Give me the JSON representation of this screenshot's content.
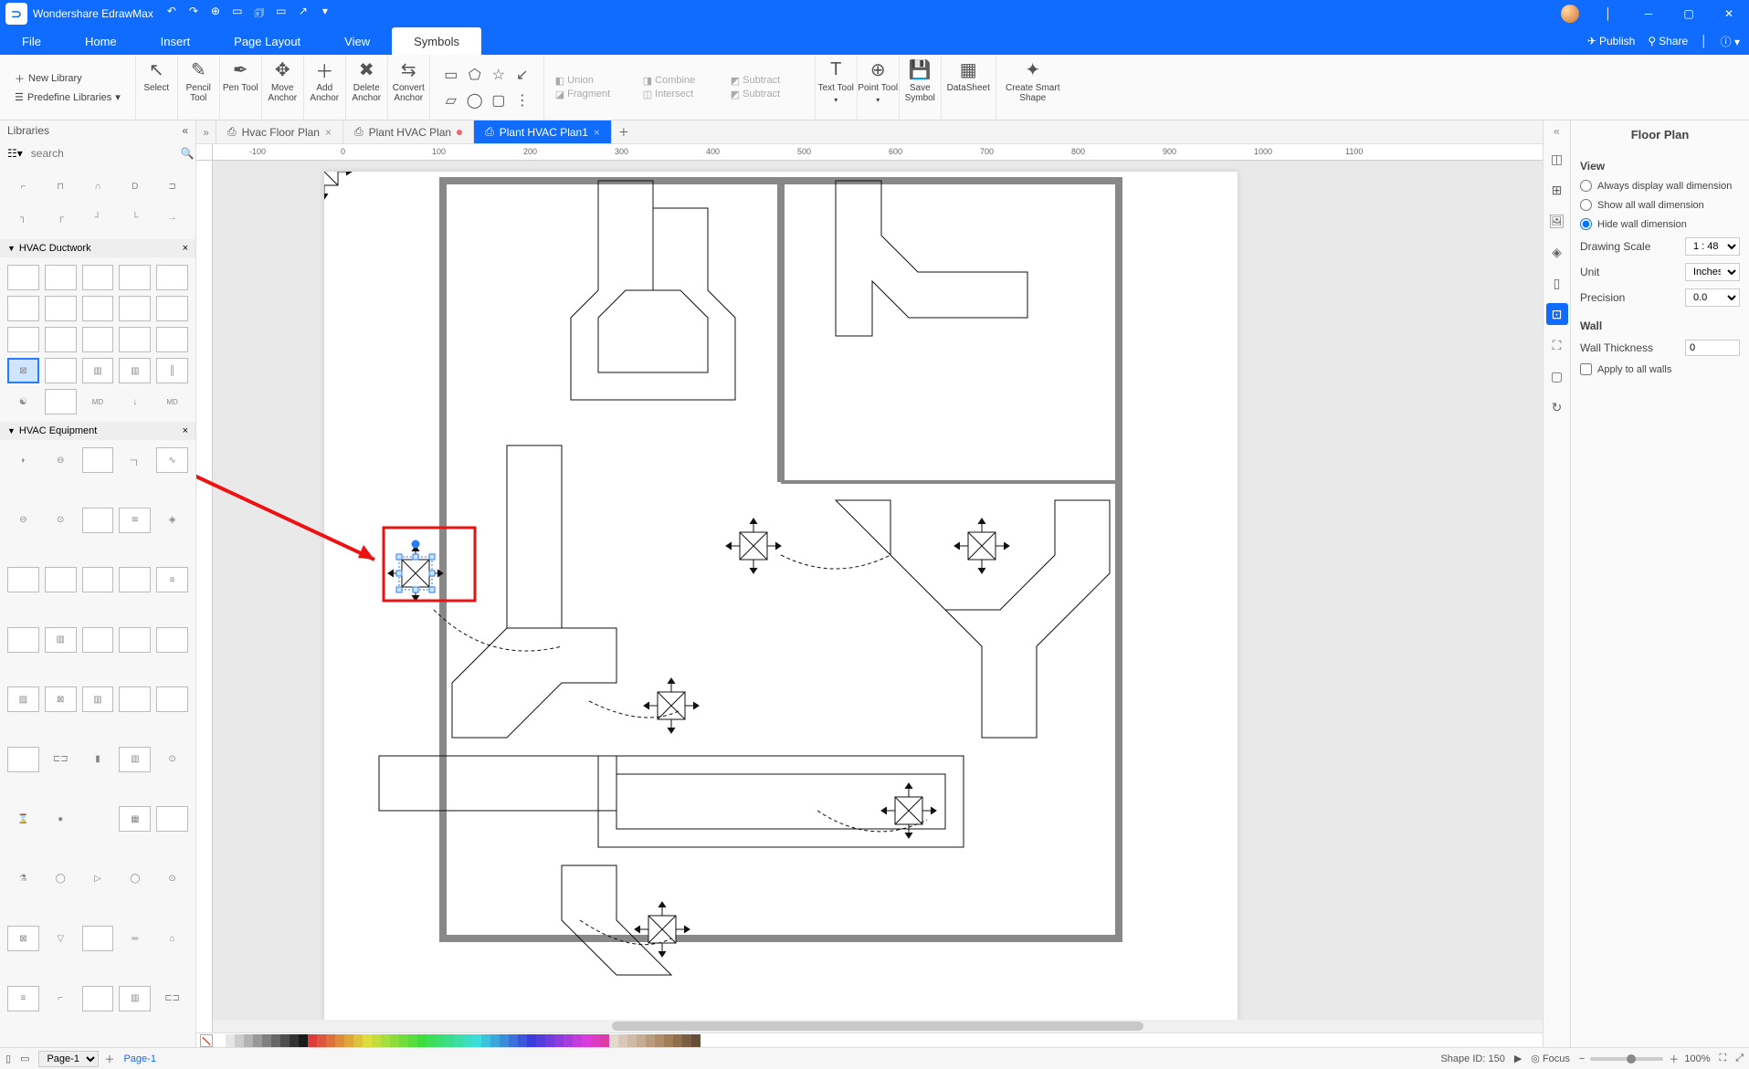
{
  "app": {
    "title": "Wondershare EdrawMax"
  },
  "titlebar_quick": [
    "↶",
    "↷",
    "⊕",
    "▭",
    "🗊",
    "▭",
    "↗",
    "▾"
  ],
  "menus": [
    "File",
    "Home",
    "Insert",
    "Page Layout",
    "View",
    "Symbols"
  ],
  "menu_active": 5,
  "menu_right": {
    "publish": "Publish",
    "share": "Share",
    "help": "?"
  },
  "ribbon": {
    "new_library": "New Library",
    "predefine": "Predefine Libraries",
    "tools": [
      {
        "icon": "↖",
        "label": "Select"
      },
      {
        "icon": "✎",
        "label": "Pencil Tool"
      },
      {
        "icon": "✒",
        "label": "Pen Tool"
      },
      {
        "icon": "✥",
        "label": "Move Anchor"
      },
      {
        "icon": "＋",
        "label": "Add Anchor"
      },
      {
        "icon": "✖",
        "label": "Delete Anchor"
      },
      {
        "icon": "⇆",
        "label": "Convert Anchor"
      }
    ],
    "shape_icons": [
      "▭",
      "⬠",
      "☆",
      "↙",
      "",
      "",
      "",
      ""
    ],
    "bool": {
      "union": "Union",
      "combine": "Combine",
      "subtract": "Subtract",
      "fragment": "Fragment",
      "intersect": "Intersect",
      "subtract2": "Subtract"
    },
    "tools2": [
      {
        "icon": "T",
        "label": "Text Tool"
      },
      {
        "icon": "⊕",
        "label": "Point Tool"
      },
      {
        "icon": "💾",
        "label": "Save Symbol"
      },
      {
        "icon": "▦",
        "label": "DataSheet"
      },
      {
        "icon": "✦",
        "label": "Create Smart Shape"
      }
    ]
  },
  "left": {
    "title": "Libraries",
    "search_ph": "search",
    "sections": [
      {
        "title": "HVAC Ductwork"
      },
      {
        "title": "HVAC Equipment"
      }
    ]
  },
  "tabs": [
    {
      "label": "Hvac Floor Plan",
      "dirty": false,
      "active": false
    },
    {
      "label": "Plant HVAC Plan",
      "dirty": true,
      "active": false
    },
    {
      "label": "Plant HVAC Plan1",
      "dirty": false,
      "active": true
    }
  ],
  "sidestrip_active": 5,
  "rightpanel": {
    "title": "Floor Plan",
    "view_label": "View",
    "radios": [
      {
        "label": "Always display wall dimension",
        "checked": false
      },
      {
        "label": "Show all wall dimension",
        "checked": false
      },
      {
        "label": "Hide wall dimension",
        "checked": true
      }
    ],
    "scale_label": "Drawing Scale",
    "scale_val": "1 : 48",
    "unit_label": "Unit",
    "unit_val": "Inches",
    "precision_label": "Precision",
    "precision_val": "0.0",
    "wall_label": "Wall",
    "thickness_label": "Wall Thickness",
    "thickness_val": "0",
    "apply_label": "Apply to all walls"
  },
  "status": {
    "page_sel": "Page-1",
    "page_tab": "Page-1",
    "shapeid_label": "Shape ID:",
    "shapeid_val": "150",
    "focus": "Focus",
    "zoom": "100%"
  },
  "ruler_marks": [
    "-100",
    "0",
    "100",
    "200",
    "300",
    "400",
    "500",
    "600",
    "700",
    "800",
    "900",
    "1000",
    "1100"
  ]
}
